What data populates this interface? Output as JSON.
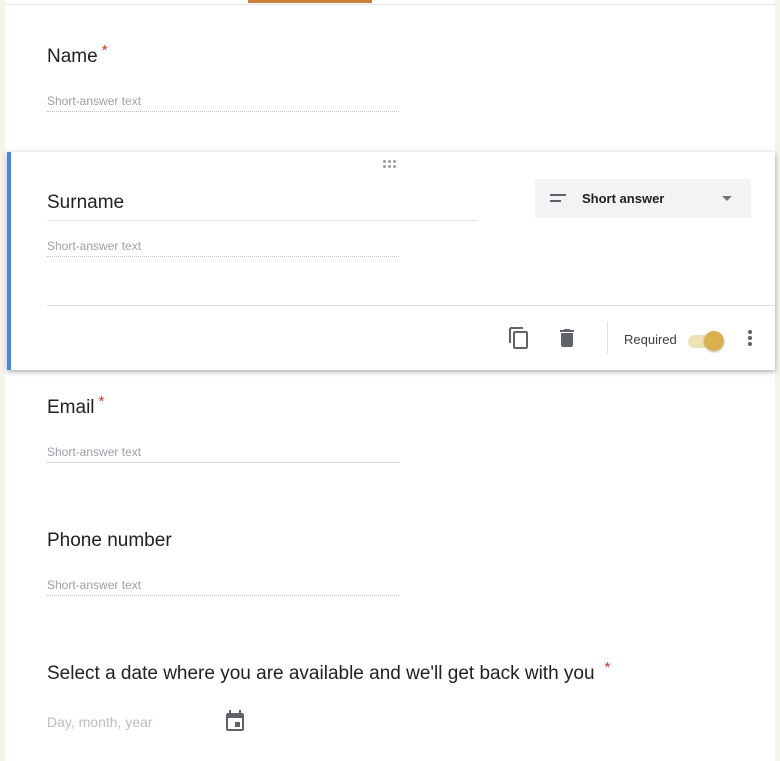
{
  "questions": {
    "name": {
      "title": "Name",
      "required_mark": "*",
      "hint": "Short-answer text"
    },
    "surname": {
      "title": "Surname",
      "hint": "Short-answer text",
      "type_label": "Short answer",
      "required_label": "Required",
      "required_on": true
    },
    "email": {
      "title": "Email",
      "required_mark": "*",
      "hint": "Short-answer text"
    },
    "phone": {
      "title": "Phone number",
      "hint": "Short-answer text"
    },
    "date": {
      "title": "Select a date where you are available and we'll get back with you",
      "required_mark": "*",
      "hint": "Day, month, year"
    }
  },
  "colors": {
    "accent": "#c9803a",
    "active_bar": "#4285f4",
    "required_star": "#d93025",
    "toggle_on": "#d9b24e"
  },
  "icons": [
    "drag-handle-icon",
    "short-answer-icon",
    "dropdown-caret-icon",
    "duplicate-icon",
    "delete-icon",
    "more-vert-icon",
    "calendar-icon"
  ]
}
